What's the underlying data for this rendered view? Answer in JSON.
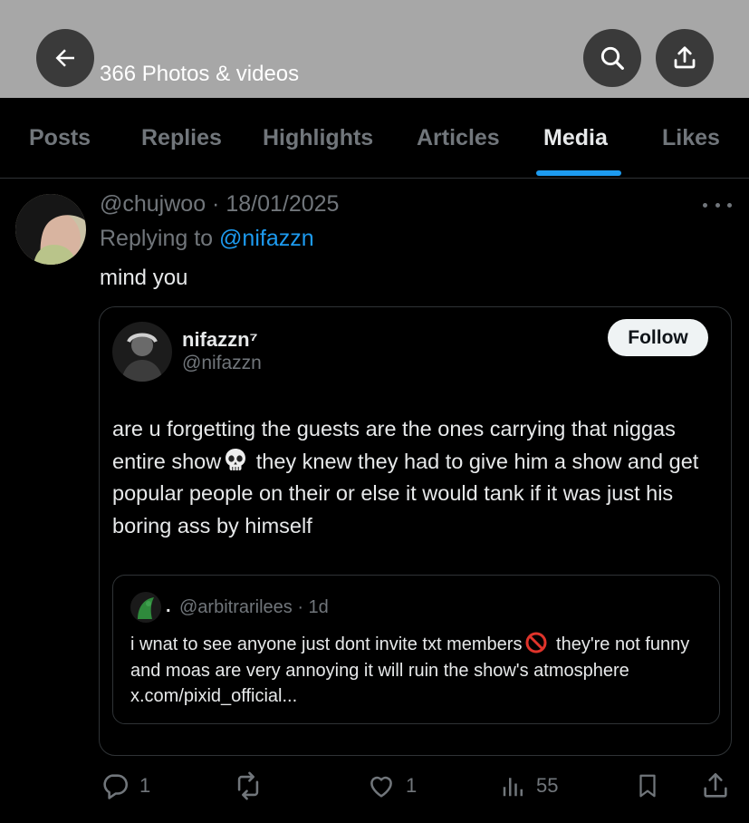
{
  "header": {
    "title": "366 Photos & videos",
    "back_icon": "arrow-left-icon",
    "search_icon": "search-icon",
    "share_icon": "share-icon"
  },
  "tabs": [
    {
      "label": "Posts",
      "active": false
    },
    {
      "label": "Replies",
      "active": false
    },
    {
      "label": "Highlights",
      "active": false
    },
    {
      "label": "Articles",
      "active": false
    },
    {
      "label": "Media",
      "active": true
    },
    {
      "label": "Likes",
      "active": false
    }
  ],
  "post": {
    "handle_date": "@chujwoo · 18/01/2025",
    "replying_prefix": "Replying to",
    "replying_handle": "@nifazzn",
    "text": "mind you",
    "quoted": {
      "name": "nifazzn⁷",
      "handle": "@nifazzn",
      "follow_label": "Follow",
      "text_before": "are u forgetting the guests are the ones carrying that niggas entire show",
      "text_after": " they knew they had to give him a show and get popular people on their or else it would tank if it was just his boring ass by himself",
      "nested": {
        "name": ".",
        "meta": "@arbitrarilees · 1d",
        "text_before": "i wnat to see anyone just dont invite txt members",
        "text_after": " they're not funny and moas are very annoying it will ruin the show's atmosphere x.com/pixid_official..."
      }
    },
    "actions": {
      "replies": "1",
      "likes": "1",
      "views": "55"
    }
  },
  "colors": {
    "accent": "#1d9bf0",
    "muted": "#71767b",
    "header_bg": "#a7a7a7"
  }
}
